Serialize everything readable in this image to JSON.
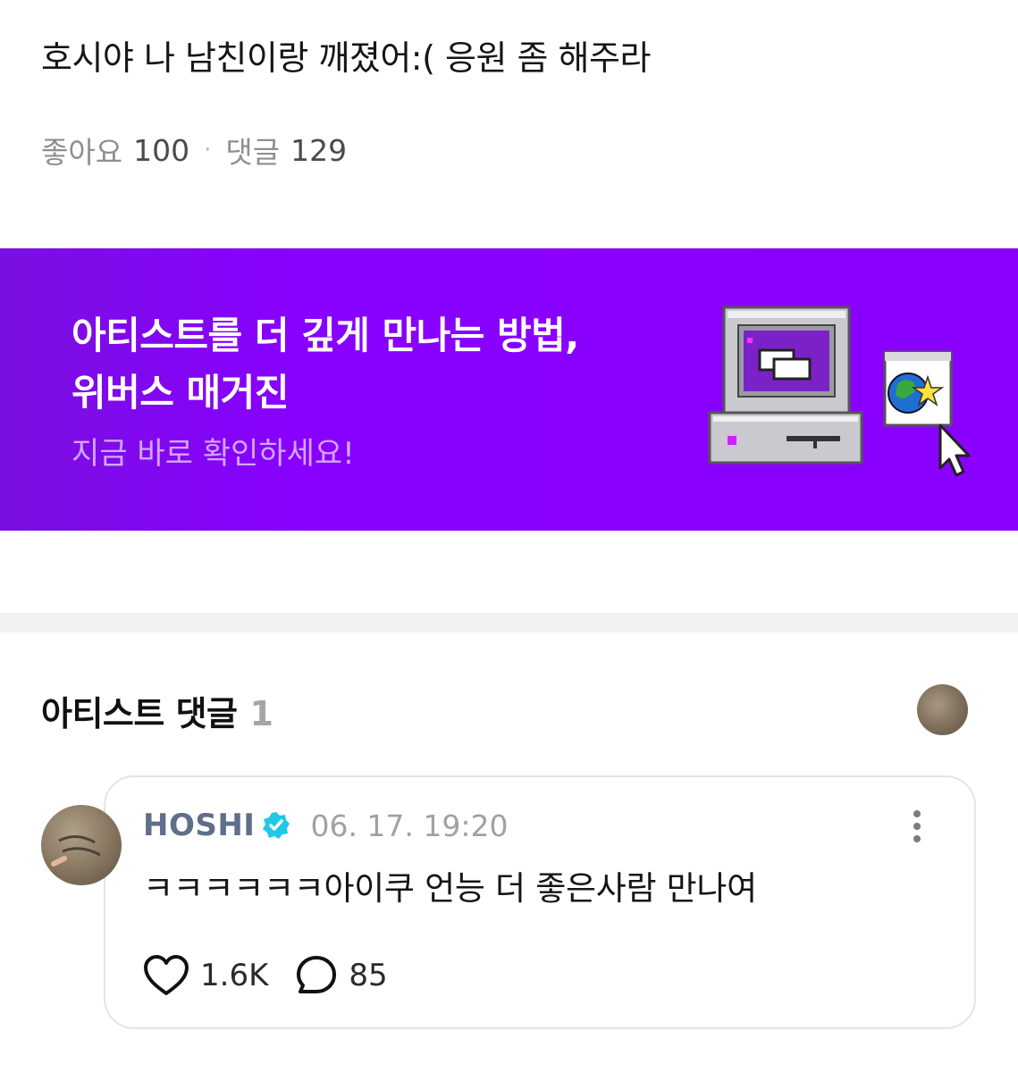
{
  "post": {
    "title": "호시야 나 남친이랑 깨졌어:( 응원 좀 해주라",
    "likes_label": "좋아요",
    "likes_count": "100",
    "comments_label": "댓글",
    "comments_count": "129"
  },
  "banner": {
    "title_line1": "아티스트를 더 깊게 만나는 방법,",
    "title_line2": "위버스 매거진",
    "subtitle": "지금 바로 확인하세요!",
    "background_color": "#8800ff",
    "subtitle_color": "#d2a6ff",
    "art_icons": [
      "retro-computer-icon",
      "globe-star-window-icon",
      "mouse-cursor-icon"
    ]
  },
  "artist_comments": {
    "title": "아티스트 댓글",
    "count": "1"
  },
  "comment": {
    "author": "HOSHI",
    "timestamp": "06. 17. 19:20",
    "text": "ㅋㅋㅋㅋㅋㅋ아이쿠 언능 더 좋은사람 만나여",
    "likes": "1.6K",
    "replies": "85",
    "verified_color": "#1ec8e6"
  }
}
